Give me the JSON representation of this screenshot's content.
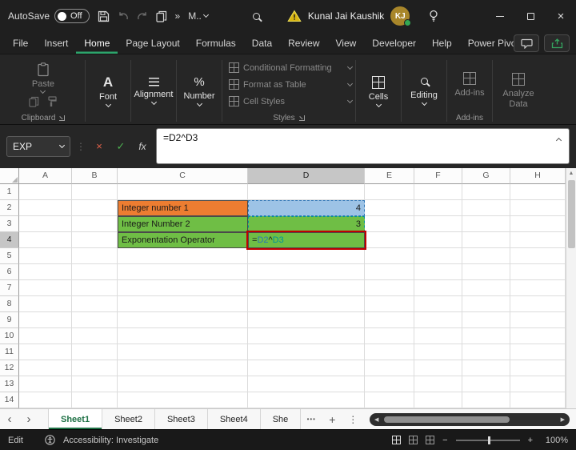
{
  "titlebar": {
    "autosave_label": "AutoSave",
    "autosave_state": "Off",
    "quick_access_overflow": "M..",
    "user_name": "Kunal Jai Kaushik",
    "user_initials": "KJ"
  },
  "menubar": {
    "tabs": [
      "File",
      "Insert",
      "Home",
      "Page Layout",
      "Formulas",
      "Data",
      "Review",
      "View",
      "Developer",
      "Help",
      "Power Pivot"
    ],
    "active_tab": "Home"
  },
  "ribbon": {
    "paste_label": "Paste",
    "clipboard_group_label": "Clipboard",
    "font_label": "Font",
    "alignment_label": "Alignment",
    "number_label": "Number",
    "styles_items": [
      "Conditional Formatting",
      "Format as Table",
      "Cell Styles"
    ],
    "styles_group_label": "Styles",
    "cells_label": "Cells",
    "editing_label": "Editing",
    "addins_label": "Add-ins",
    "addins_group_label": "Add-ins",
    "analyze_data_label": "Analyze Data"
  },
  "formula_bar": {
    "name_box_value": "EXP",
    "formula": "=D2^D3"
  },
  "grid": {
    "col_headers": [
      "A",
      "B",
      "C",
      "D",
      "E",
      "F",
      "G",
      "H"
    ],
    "row_count": 14,
    "selected_col": "D",
    "selected_row": 4,
    "cells": [
      {
        "c": "C",
        "r": 2,
        "text": "Integer number 1",
        "bg": "#ED7D31",
        "align": "left",
        "bordered": true
      },
      {
        "c": "D",
        "r": 2,
        "text": "4",
        "bg": "#9DC3E6",
        "align": "right",
        "ref_border": "#2E75B6"
      },
      {
        "c": "C",
        "r": 3,
        "text": "Integer Number 2",
        "bg": "#6FBE45",
        "align": "left",
        "bordered": true
      },
      {
        "c": "D",
        "r": 3,
        "text": "3",
        "bg": "#6FBE45",
        "align": "right",
        "ref_border": "#00939C"
      },
      {
        "c": "C",
        "r": 4,
        "text": "Exponentation Operator",
        "bg": "#6FBE45",
        "align": "left",
        "bordered": true
      },
      {
        "c": "D",
        "r": 4,
        "bg": "#6FBE45",
        "align": "left",
        "annotated": true,
        "formula_parts": [
          {
            "text": "=",
            "color": "#1a1a1a"
          },
          {
            "text": "D2",
            "color": "#2E75B6"
          },
          {
            "text": "^",
            "color": "#1a1a1a"
          },
          {
            "text": "D3",
            "color": "#00939C"
          }
        ]
      }
    ]
  },
  "sheetbar": {
    "tabs": [
      "Sheet1",
      "Sheet2",
      "Sheet3",
      "Sheet4",
      "She"
    ],
    "active_tab": "Sheet1"
  },
  "statusbar": {
    "mode": "Edit",
    "accessibility_text": "Accessibility: Investigate",
    "zoom_level": "100%"
  },
  "icons": {
    "more_chevrons": "»",
    "font_glyph": "A",
    "percent_glyph": "%",
    "close": "×",
    "cancel": "×",
    "check": "✓",
    "fx": "fx",
    "ellipsis": "•••",
    "plus": "+",
    "kebab": "⋮",
    "nav_left": "‹",
    "nav_right": "›",
    "scroll_left": "◀",
    "scroll_right": "▶",
    "up_arrow": "▲",
    "zoom_minus": "−",
    "zoom_plus": "+"
  },
  "colors": {
    "accent_green": "#2DA56C",
    "annotation_red": "#C00000",
    "cell_orange": "#ED7D31",
    "cell_blue": "#9DC3E6",
    "cell_green": "#6FBE45"
  }
}
